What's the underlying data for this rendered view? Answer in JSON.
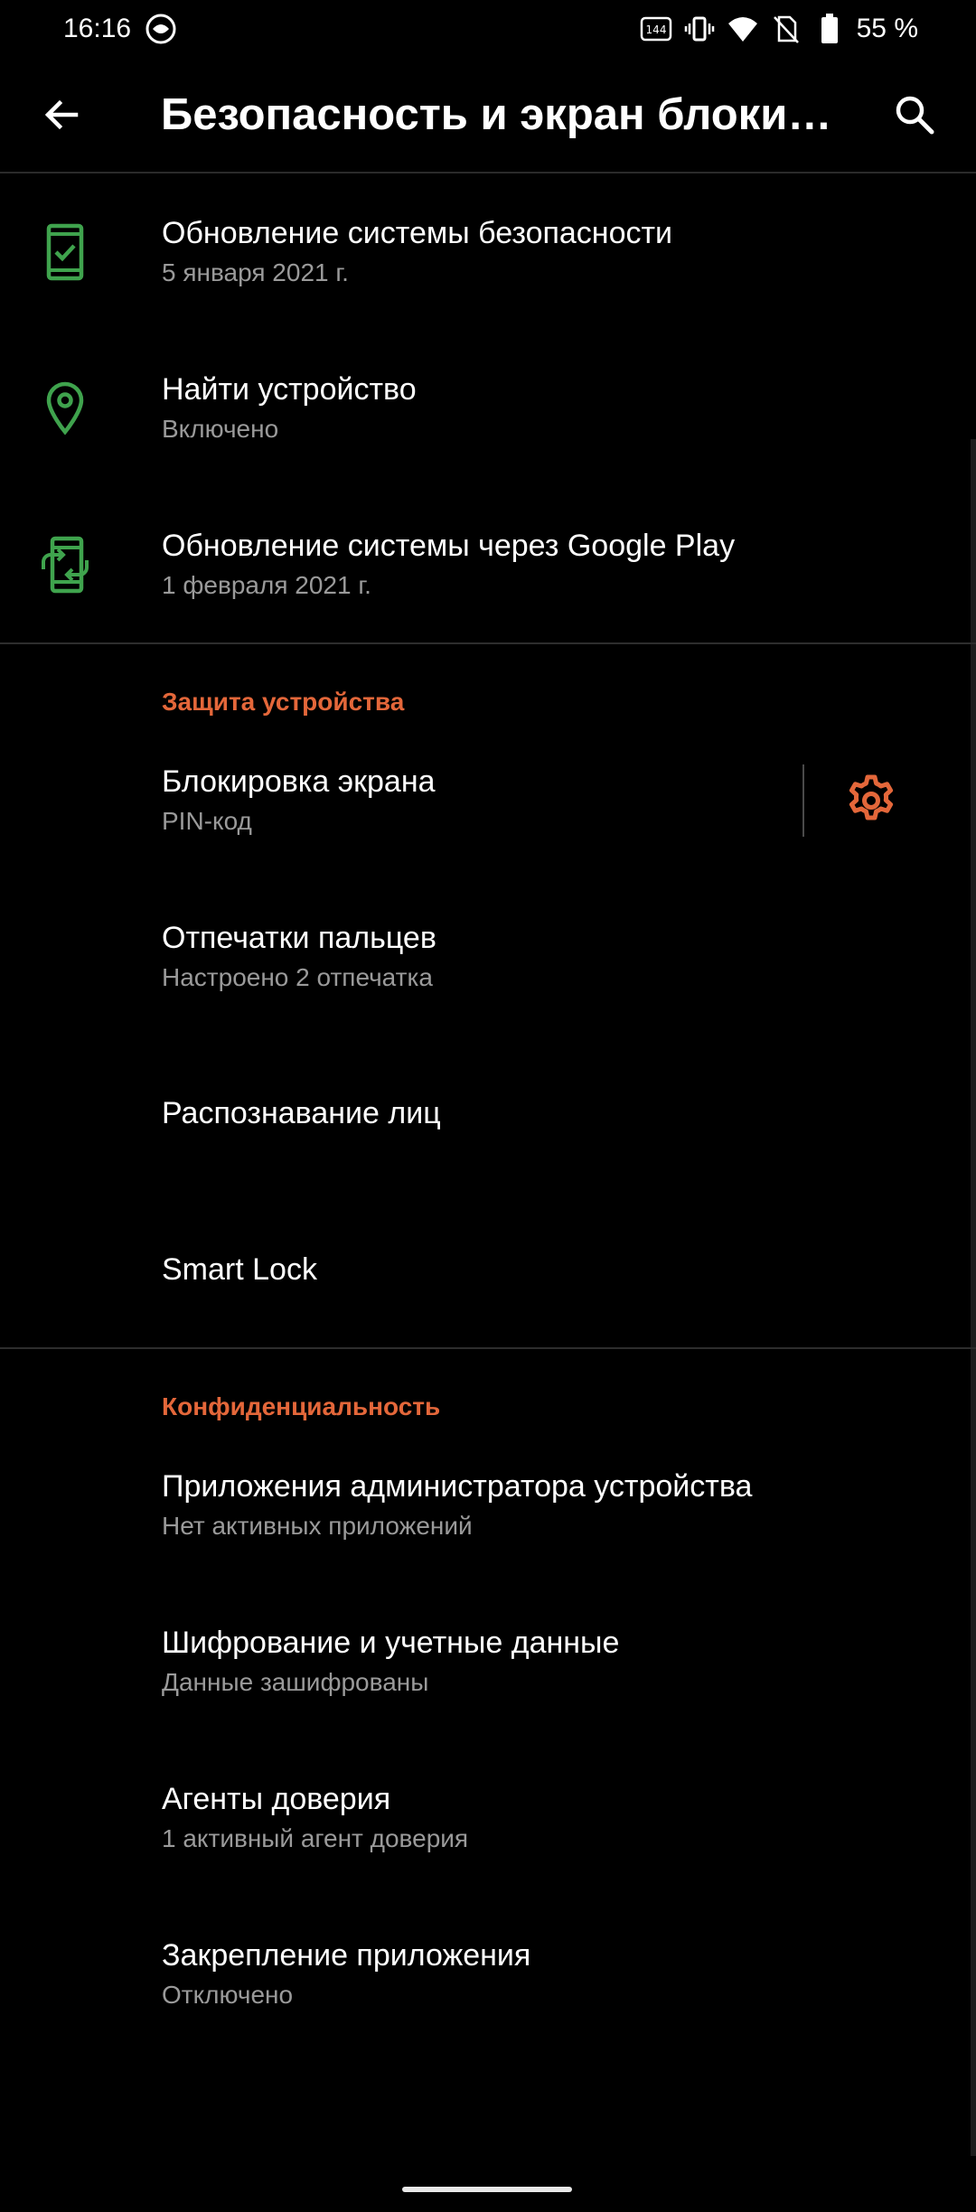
{
  "status_bar": {
    "time": "16:16",
    "battery_percent": "55 %",
    "icons": [
      "refresh-rate-icon",
      "vibrate-icon",
      "wifi-icon",
      "no-sim-icon",
      "battery-icon"
    ]
  },
  "app_bar": {
    "title": "Безопасность и экран блоки…",
    "back_icon": "arrow-left-icon",
    "search_icon": "search-icon"
  },
  "colors": {
    "accent": "#e4673a",
    "icon_green": "#3fa34d",
    "background": "#000000",
    "secondary_text": "#9a9a9a"
  },
  "top_items": [
    {
      "title": "Обновление системы безопасности",
      "subtitle": "5 января 2021 г.",
      "icon": "phone-check-icon"
    },
    {
      "title": "Найти устройство",
      "subtitle": "Включено",
      "icon": "location-pin-icon"
    },
    {
      "title": "Обновление системы через Google Play",
      "subtitle": "1 февраля 2021 г.",
      "icon": "phone-update-icon"
    }
  ],
  "device_protection": {
    "header": "Защита устройства",
    "items": [
      {
        "title": "Блокировка экрана",
        "subtitle": "PIN-код"
      },
      {
        "title": "Отпечатки пальцев",
        "subtitle": "Настроено 2 отпечатка"
      },
      {
        "title": "Распознавание лиц",
        "subtitle": ""
      },
      {
        "title": "Smart Lock",
        "subtitle": ""
      }
    ]
  },
  "privacy": {
    "header": "Конфиденциальность",
    "items": [
      {
        "title": "Приложения администратора устройства",
        "subtitle": "Нет активных приложений"
      },
      {
        "title": "Шифрование и учетные данные",
        "subtitle": "Данные зашифрованы"
      },
      {
        "title": "Агенты доверия",
        "subtitle": "1 активный агент доверия"
      },
      {
        "title": "Закрепление приложения",
        "subtitle": "Отключено"
      }
    ]
  }
}
